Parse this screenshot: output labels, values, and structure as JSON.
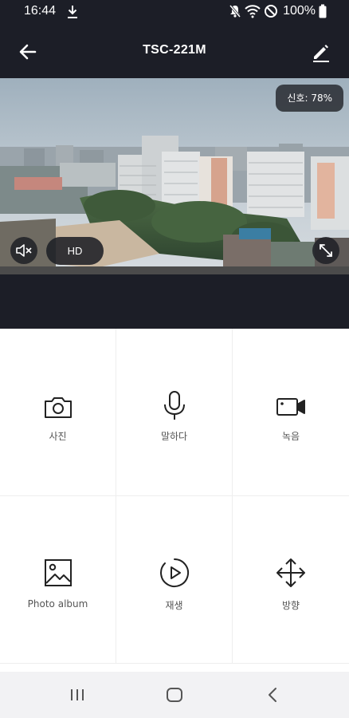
{
  "status_bar": {
    "time": "16:44",
    "battery": "100%",
    "icons": [
      "download-icon",
      "mute-icon",
      "wifi-icon",
      "dnd-icon",
      "battery-icon"
    ]
  },
  "app_bar": {
    "title": "TSC-221M",
    "back_icon": "arrow-left-icon",
    "edit_icon": "pencil-icon"
  },
  "video": {
    "signal_text": "신호: 78%",
    "quality_label": "HD",
    "mute_icon": "speaker-mute-icon",
    "fullscreen_icon": "fullscreen-icon"
  },
  "controls": [
    {
      "label": "사진",
      "icon": "camera-icon"
    },
    {
      "label": "말하다",
      "icon": "microphone-icon"
    },
    {
      "label": "녹음",
      "icon": "video-camera-icon"
    },
    {
      "label": "Photo album",
      "icon": "image-icon"
    },
    {
      "label": "재생",
      "icon": "play-circle-icon"
    },
    {
      "label": "방향",
      "icon": "move-arrows-icon"
    }
  ],
  "nav_bar": {
    "icons": [
      "recents-icon",
      "home-icon",
      "back-icon"
    ]
  },
  "colors": {
    "header_bg": "#1c1e27",
    "icon_stroke": "#222222",
    "label": "#555555",
    "nav_bg": "#f2f2f4"
  }
}
